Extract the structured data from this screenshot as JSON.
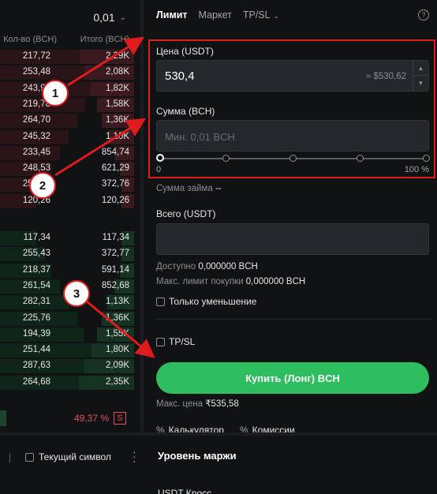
{
  "orderbook": {
    "precision": "0,01",
    "col_qty": "Кол-во (BCH)",
    "col_total": "Итого (BCH)",
    "asks": [
      {
        "qty": "217,72",
        "total": "2,29K",
        "fill": 0.9
      },
      {
        "qty": "253,48",
        "total": "2,08K",
        "fill": 0.82
      },
      {
        "qty": "243,99",
        "total": "1,82K",
        "fill": 0.72
      },
      {
        "qty": "219,78",
        "total": "1,58K",
        "fill": 0.62
      },
      {
        "qty": "264,70",
        "total": "1,36K",
        "fill": 0.53
      },
      {
        "qty": "245,32",
        "total": "1,10K",
        "fill": 0.43
      },
      {
        "qty": "233,45",
        "total": "854,74",
        "fill": 0.33
      },
      {
        "qty": "248,53",
        "total": "621,29",
        "fill": 0.24
      },
      {
        "qty": "253,00",
        "total": "372,76",
        "fill": 0.15
      },
      {
        "qty": "120,26",
        "total": "120,26",
        "fill": 0.05
      }
    ],
    "bids": [
      {
        "qty": "117,34",
        "total": "117,34",
        "fill": 0.05
      },
      {
        "qty": "255,43",
        "total": "372,77",
        "fill": 0.15
      },
      {
        "qty": "218,37",
        "total": "591,14",
        "fill": 0.23
      },
      {
        "qty": "261,54",
        "total": "852,68",
        "fill": 0.33
      },
      {
        "qty": "282,31",
        "total": "1,13K",
        "fill": 0.44
      },
      {
        "qty": "225,76",
        "total": "1,36K",
        "fill": 0.53
      },
      {
        "qty": "194,39",
        "total": "1,55K",
        "fill": 0.61
      },
      {
        "qty": "251,44",
        "total": "1,80K",
        "fill": 0.71
      },
      {
        "qty": "287,63",
        "total": "2,09K",
        "fill": 0.82
      },
      {
        "qty": "264,68",
        "total": "2,35K",
        "fill": 0.92
      }
    ],
    "sell_ratio": "49,37 %",
    "sell_badge": "S"
  },
  "order_form": {
    "tabs": [
      "Лимит",
      "Маркет",
      "TP/SL"
    ],
    "help": "?",
    "price_label": "Цена (USDT)",
    "price_value": "530,4",
    "price_usd": "≈ $530,62",
    "amount_label": "Сумма (BCH)",
    "amount_placeholder": "Мин. 0,01 BCH",
    "slider_min": "0",
    "slider_max": "100 %",
    "loan_label": "Сумма займа",
    "loan_value": "--",
    "total_label": "Всего (USDT)",
    "available_label": "Доступно",
    "available_value": "0,000000 BCH",
    "max_buy_label": "Макс. лимит покупки",
    "max_buy_value": "0,000000 BCH",
    "reduce_only": "Только уменьшение",
    "tpsl": "TP/SL",
    "buy_button": "Купить (Лонг) BCH",
    "max_price_label": "Макс. цена",
    "max_price_value": "₹535,58",
    "calculator": "Калькулятор",
    "fees": "Комиссии"
  },
  "bottom": {
    "current_symbol": "Текущий символ",
    "margin_title": "Уровень маржи",
    "margin_mode": "USDT Кросс"
  },
  "annotations": [
    "1",
    "2",
    "3"
  ],
  "colors": {
    "buy": "#2ebd5f",
    "sell": "#e2505c",
    "highlight": "#e01b1b"
  }
}
